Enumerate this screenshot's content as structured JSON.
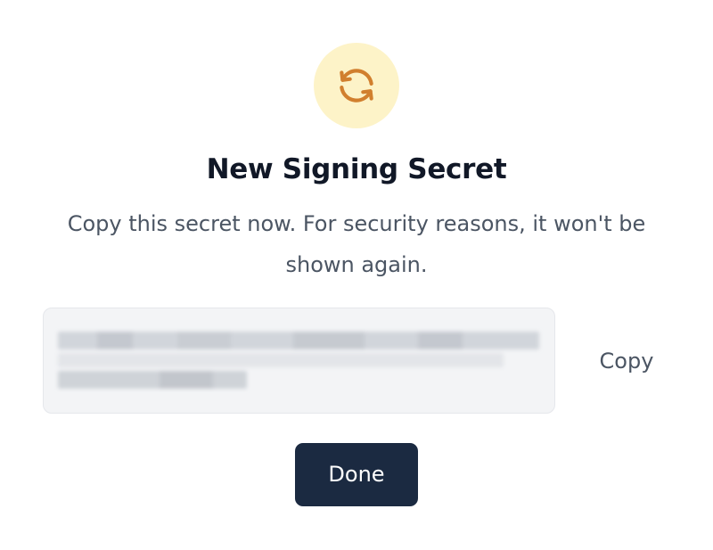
{
  "dialog": {
    "icon": "refresh-icon",
    "title": "New Signing Secret",
    "description": "Copy this secret now. For security reasons, it won't be shown again.",
    "secret": {
      "value_obscured": true
    },
    "copy_label": "Copy",
    "done_label": "Done"
  },
  "colors": {
    "icon_bg": "#fdf3c8",
    "icon_stroke": "#d17f2e",
    "primary_button": "#1b2a41",
    "secret_bg": "#f3f4f6"
  }
}
